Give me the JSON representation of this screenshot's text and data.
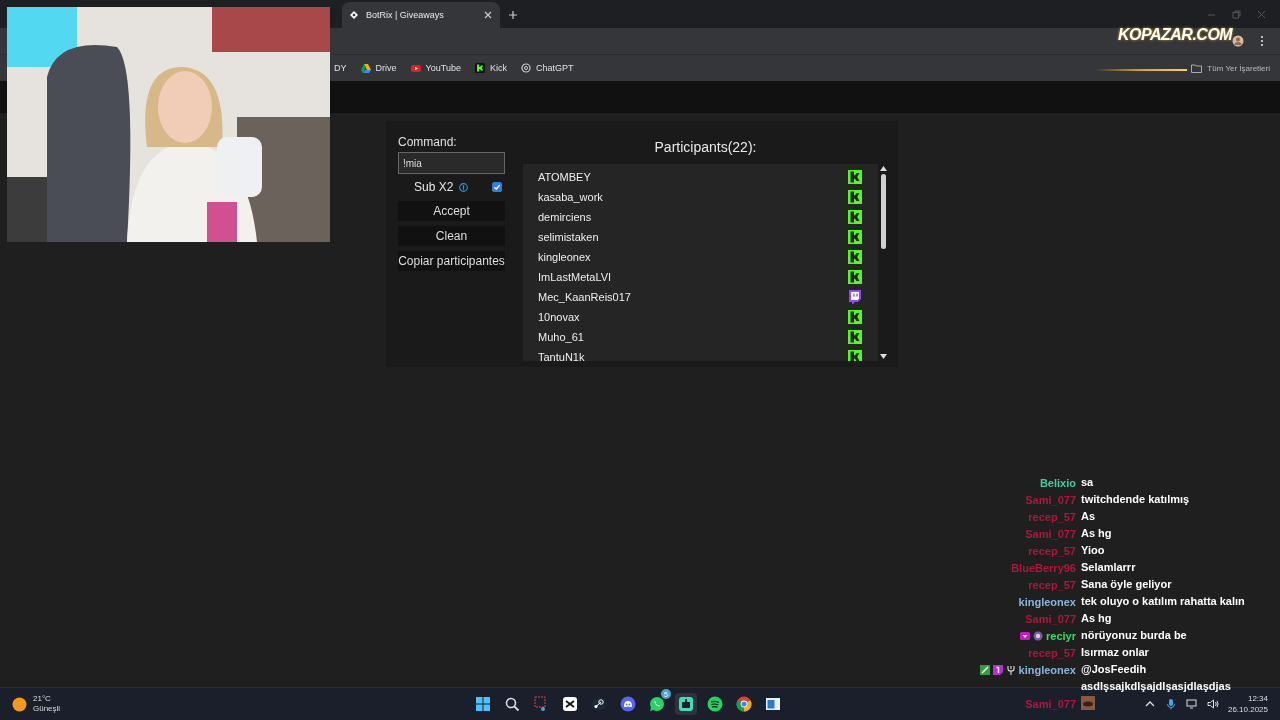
{
  "browser": {
    "tab": {
      "title": "BotRix | Giveaways",
      "selected": true
    },
    "bookmarks": [
      {
        "label": "DY",
        "kind": "plain"
      },
      {
        "label": "Drive",
        "kind": "drive"
      },
      {
        "label": "YouTube",
        "kind": "youtube"
      },
      {
        "label": "Kick",
        "kind": "kick"
      },
      {
        "label": "ChatGPT",
        "kind": "chatgpt"
      }
    ],
    "all_bookmarks": "Tüm Yer İşaretleri"
  },
  "stream_logo": "KOPAZAR.COM",
  "giveaway": {
    "command_label": "Command:",
    "command_value": "!mia",
    "sub_x2": {
      "label": "Sub X2",
      "checked": true
    },
    "buttons": [
      "Accept",
      "Clean",
      "Copiar participantes"
    ],
    "participants_title": "Participants(22):",
    "participants": [
      {
        "name": "ATOMBEY",
        "kind": "kick"
      },
      {
        "name": "kasaba_work",
        "kind": "kick"
      },
      {
        "name": "demirciens",
        "kind": "kick"
      },
      {
        "name": "selimistaken",
        "kind": "kick"
      },
      {
        "name": "kingleonex",
        "kind": "kick"
      },
      {
        "name": "ImLastMetaLVI",
        "kind": "kick"
      },
      {
        "name": "Mec_KaanReis017",
        "kind": "twitch"
      },
      {
        "name": "10novax",
        "kind": "kick"
      },
      {
        "name": "Muho_61",
        "kind": "kick"
      },
      {
        "name": "TantuN1k",
        "kind": "kick"
      }
    ]
  },
  "chat": [
    {
      "name": "Belixio",
      "color": "#3fcf9c",
      "message": "sa"
    },
    {
      "name": "Sami_077",
      "color": "#b0163c",
      "message": "twitchdende katılmış"
    },
    {
      "name": "recep_57",
      "color": "#b0163c",
      "message": "As"
    },
    {
      "name": "Sami_077",
      "color": "#b0163c",
      "message": "As hg"
    },
    {
      "name": "recep_57",
      "color": "#b0163c",
      "message": "Yioo"
    },
    {
      "name": "BlueBerry96",
      "color": "#b0163c",
      "message": "Selamlarrr"
    },
    {
      "name": "recep_57",
      "color": "#b0163c",
      "message": "Sana öyle geliyor"
    },
    {
      "name": "kingleonex",
      "color": "#8db4de",
      "message": "tek oluyo o katılım rahatta kalın"
    },
    {
      "name": "Sami_077",
      "color": "#b0163c",
      "message": "As hg"
    },
    {
      "name": "reciyr",
      "color": "#2fe05c",
      "message": "nörüyonuz burda be",
      "badges": [
        {
          "kind": "gift"
        },
        {
          "kind": "emblem"
        }
      ]
    },
    {
      "name": "recep_57",
      "color": "#b0163c",
      "message": "Isırmaz onlar"
    },
    {
      "name": "kingleonex",
      "color": "#8db4de",
      "message": "@JosFeedih asdlşsajkdlşajdlşasjdlaşdjas",
      "badges": [
        {
          "kind": "sword"
        },
        {
          "kind": "sub"
        },
        {
          "kind": "fork"
        }
      ]
    },
    {
      "name": "Sami_077",
      "color": "#b0163c",
      "kind": "emote"
    }
  ],
  "taskbar": {
    "weather": {
      "temperature": "21°C",
      "condition": "Güneşli"
    },
    "apps": [
      {
        "kind": "start"
      },
      {
        "kind": "search"
      },
      {
        "kind": "snip"
      },
      {
        "kind": "capcut"
      },
      {
        "kind": "steam"
      },
      {
        "kind": "discord"
      },
      {
        "kind": "whatsapp",
        "badge": "5"
      },
      {
        "kind": "botrix",
        "selected": true
      },
      {
        "kind": "spotify"
      },
      {
        "kind": "chrome"
      },
      {
        "kind": "window"
      }
    ],
    "time": "12:34",
    "date": "26.10.2025"
  }
}
